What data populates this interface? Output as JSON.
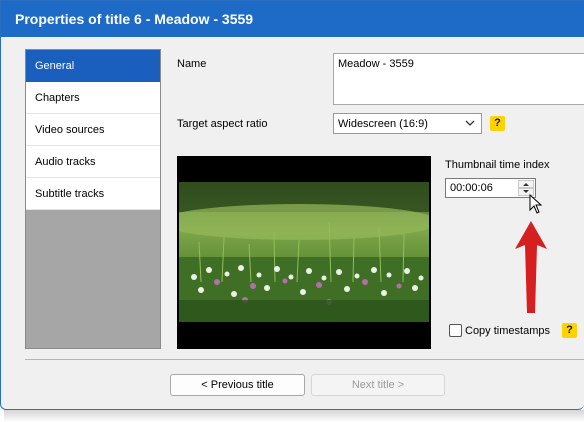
{
  "window": {
    "title": "Properties of title 6 - Meadow - 3559"
  },
  "sidebar": {
    "items": [
      {
        "label": "General"
      },
      {
        "label": "Chapters"
      },
      {
        "label": "Video sources"
      },
      {
        "label": "Audio tracks"
      },
      {
        "label": "Subtitle tracks"
      }
    ],
    "selected_index": 0
  },
  "general": {
    "name_label": "Name",
    "name_value": "Meadow - 3559",
    "aspect_label": "Target aspect ratio",
    "aspect_value": "Widescreen (16:9)",
    "help_glyph": "?",
    "thumbnail_label": "Thumbnail time index",
    "thumbnail_value": "00:00:06",
    "copy_timestamps_label": "Copy timestamps",
    "copy_timestamps_checked": false
  },
  "footer": {
    "previous_label": "< Previous title",
    "next_label": "Next title >",
    "next_enabled": false
  },
  "colors": {
    "titlebar": "#1e6ac7",
    "selection": "#1a5fbd",
    "help_badge": "#ffd300",
    "annotation_arrow": "#d61f1f"
  },
  "icons": {
    "combo": "chevron-down-icon",
    "spinner_up": "spin-up-icon",
    "spinner_down": "spin-down-icon",
    "cursor": "mouse-pointer-icon",
    "annotation": "red-arrow-icon"
  }
}
